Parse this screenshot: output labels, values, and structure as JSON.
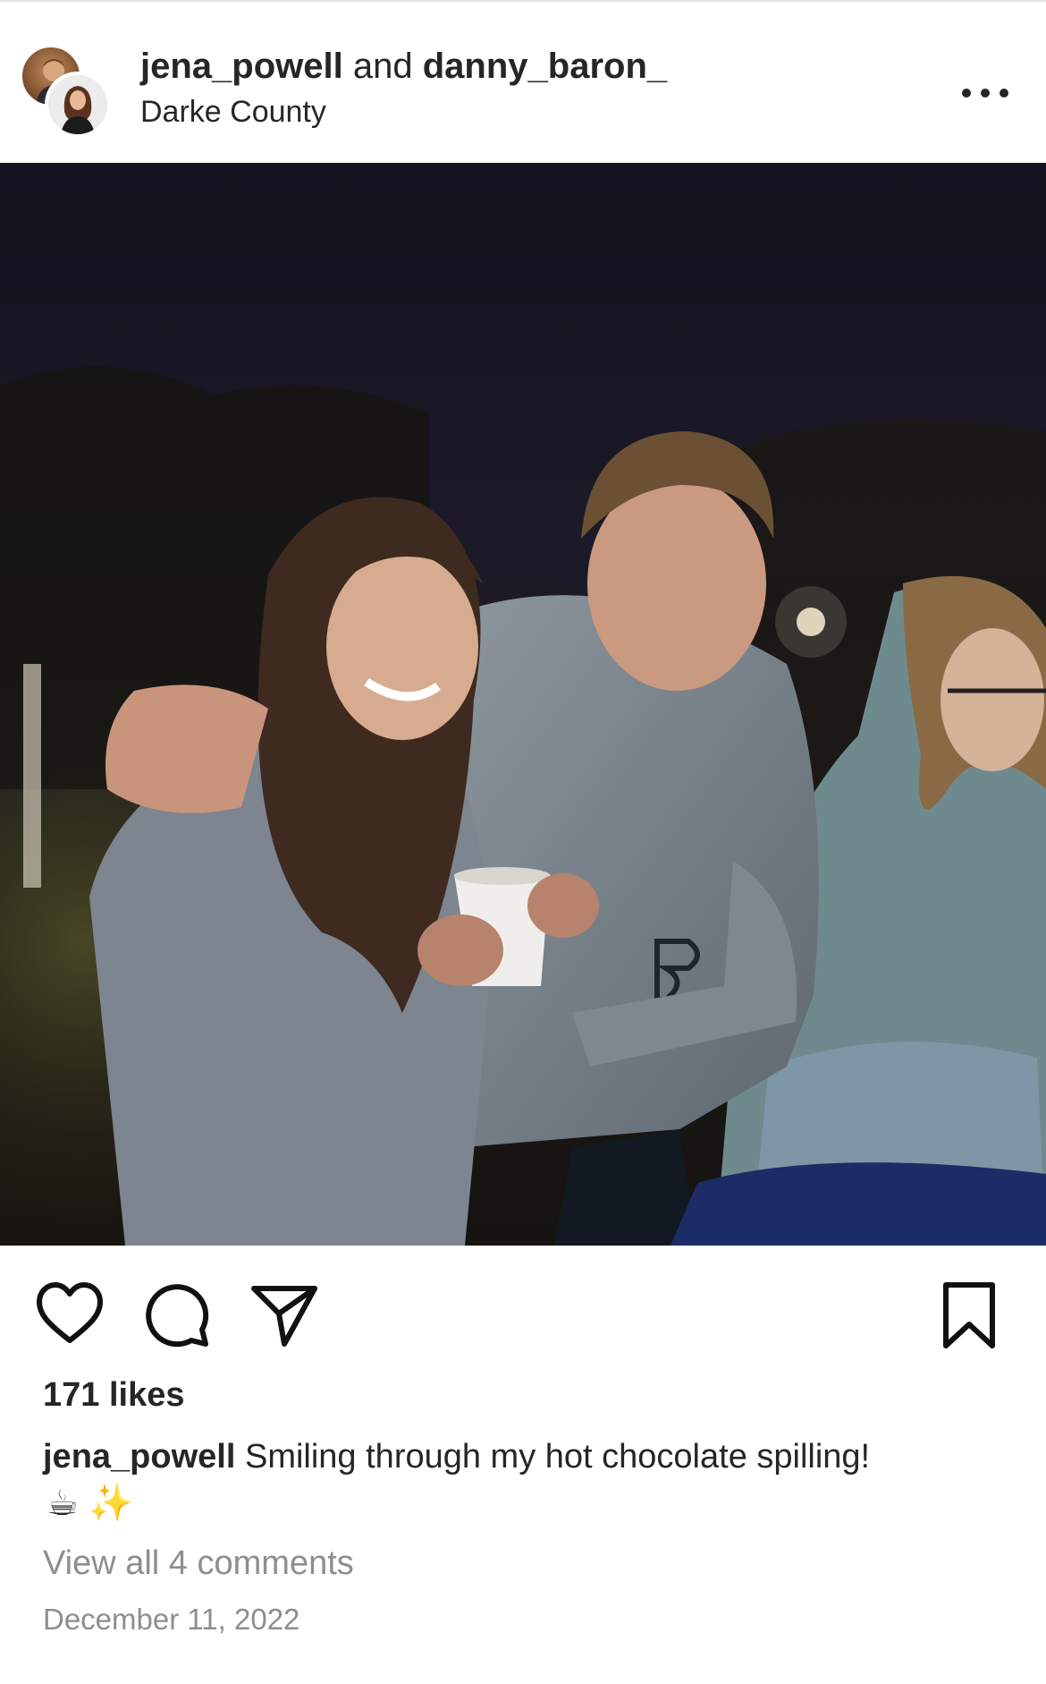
{
  "header": {
    "user_primary": "jena_powell",
    "conjunction": " and ",
    "user_secondary": "danny_baron_",
    "location": "Darke County",
    "more_icon": "more-horizontal-icon"
  },
  "post": {
    "image_subject": "photo",
    "actions": {
      "like_icon": "heart-icon",
      "comment_icon": "comment-icon",
      "share_icon": "send-icon",
      "save_icon": "bookmark-icon"
    },
    "likes_text": "171 likes",
    "caption_user": "jena_powell",
    "caption_text": "Smiling through my hot chocolate spilling!",
    "caption_emojis": "☕ ✨",
    "view_comments": "View all 4 comments",
    "date": "December 11, 2022"
  },
  "colors": {
    "text": "#262626",
    "muted": "#8e8e8e",
    "background": "#ffffff"
  }
}
